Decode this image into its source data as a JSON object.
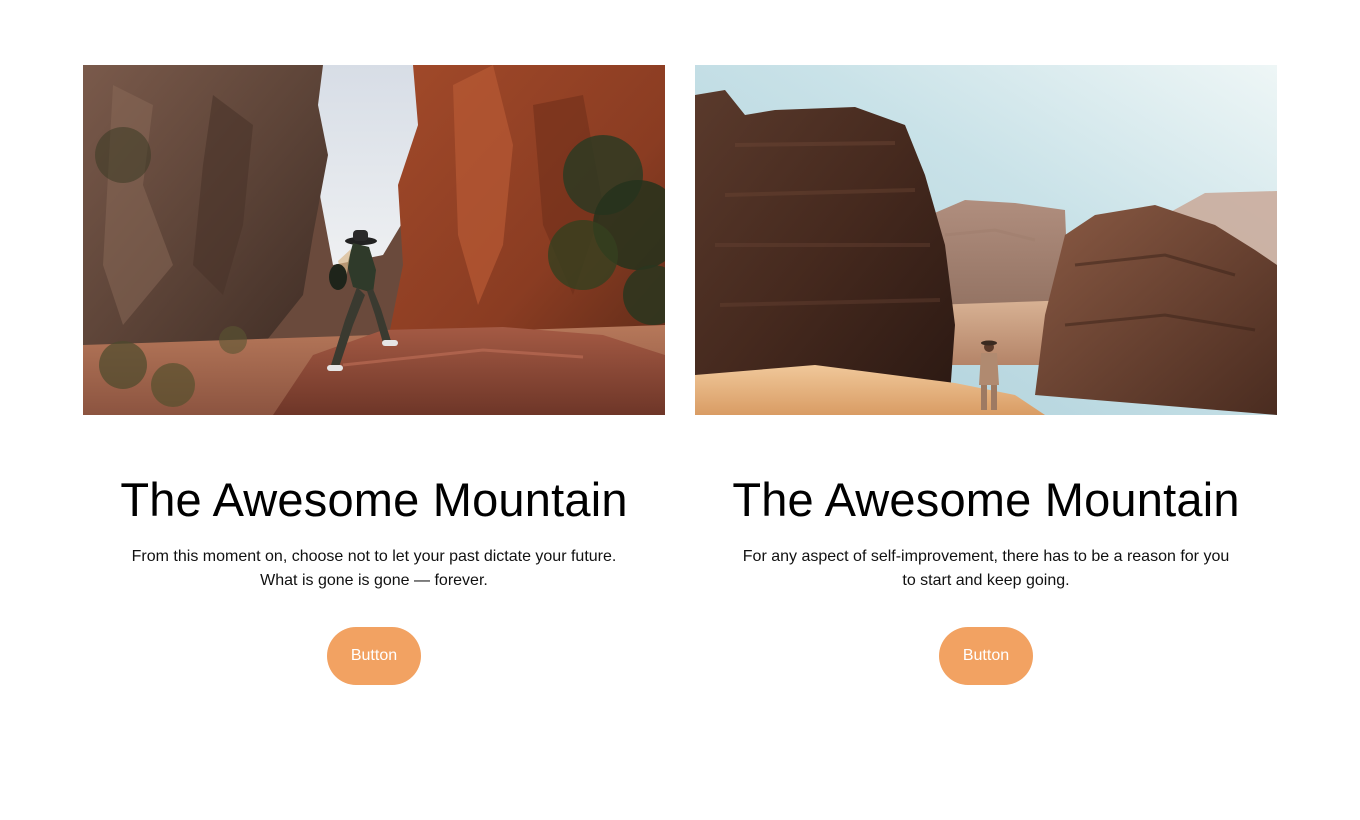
{
  "cards": [
    {
      "title": "The Awesome Mountain",
      "text": "From this moment on, choose not to let your past dictate your future. What is gone is gone — forever.",
      "button_label": "Button",
      "image": "canyon-hiker-climbing-rock-photo"
    },
    {
      "title": "The Awesome Mountain",
      "text": "For any aspect of self-improvement, there has to be a reason for you to start and keep going.",
      "button_label": "Button",
      "image": "desert-rock-formations-traveler-photo"
    }
  ],
  "colors": {
    "button_bg": "#f2a262",
    "button_text": "#ffffff",
    "background": "#ffffff",
    "text": "#000000"
  }
}
